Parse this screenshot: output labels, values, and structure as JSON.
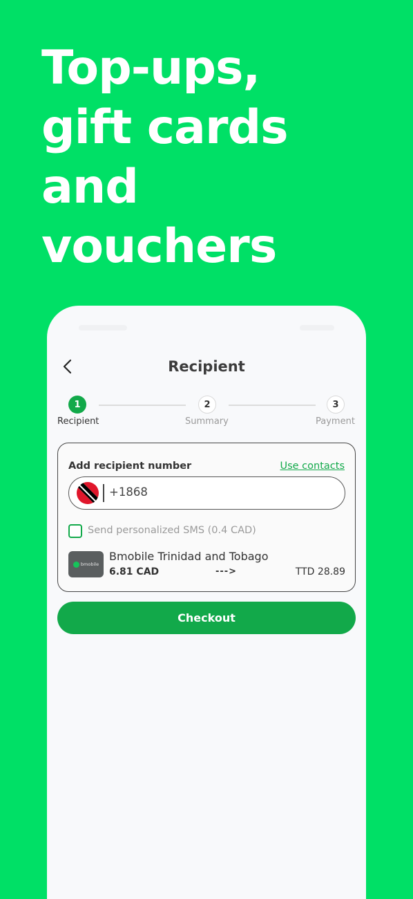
{
  "headline": {
    "lines": [
      "Top-ups,",
      "gift cards",
      "and",
      "vouchers"
    ]
  },
  "screen": {
    "title": "Recipient",
    "back_icon": "chevron-left-icon",
    "steps": [
      {
        "number": "1",
        "label": "Recipient",
        "active": true
      },
      {
        "number": "2",
        "label": "Summary",
        "active": false
      },
      {
        "number": "3",
        "label": "Payment",
        "active": false
      }
    ],
    "card": {
      "title": "Add recipient number",
      "use_contacts": "Use contacts",
      "country_flag": "trinidad-and-tobago-flag",
      "phone_value": "+1868",
      "sms_label": "Send personalized SMS (0.4 CAD)",
      "sms_checked": false,
      "operator": {
        "logo_text": "bmobile",
        "name": "Bmobile Trinidad and Tobago",
        "send_amount": "6.81 CAD",
        "arrow": "--->",
        "receive_amount": "TTD 28.89"
      }
    },
    "checkout_label": "Checkout"
  },
  "colors": {
    "background": "#00e066",
    "accent": "#12a94a",
    "screen_bg": "#f8f9fb"
  }
}
